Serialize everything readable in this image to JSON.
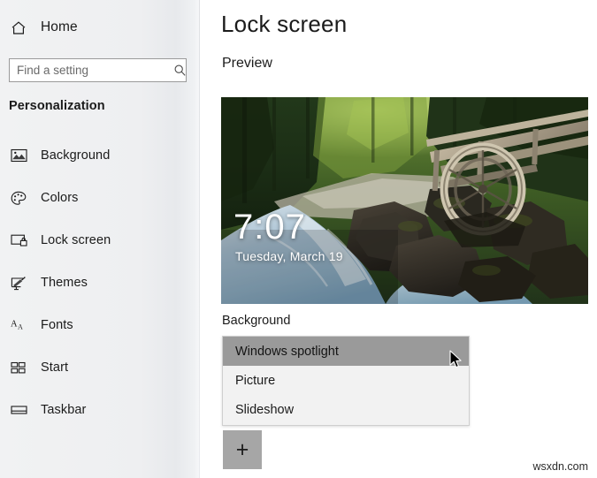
{
  "sidebar": {
    "home": {
      "label": "Home",
      "icon": "home-icon"
    },
    "search": {
      "value": "",
      "placeholder": "Find a setting",
      "icon": "search-icon"
    },
    "group_title": "Personalization",
    "items": [
      {
        "label": "Background",
        "icon": "picture-icon"
      },
      {
        "label": "Colors",
        "icon": "palette-icon"
      },
      {
        "label": "Lock screen",
        "icon": "lock-screen-icon"
      },
      {
        "label": "Themes",
        "icon": "themes-brush-icon"
      },
      {
        "label": "Fonts",
        "icon": "fonts-aa-icon"
      },
      {
        "label": "Start",
        "icon": "start-tiles-icon"
      },
      {
        "label": "Taskbar",
        "icon": "taskbar-icon"
      }
    ]
  },
  "main": {
    "page_title": "Lock screen",
    "preview_label": "Preview",
    "preview": {
      "clock": "7:07",
      "date": "Tuesday, March 19",
      "image_description": "forest stream with wooden water mill wheel"
    },
    "background_section": {
      "label": "Background",
      "selected": "Windows spotlight",
      "options": [
        "Windows spotlight",
        "Picture",
        "Slideshow"
      ]
    },
    "add_button": {
      "label": "+",
      "icon": "plus-icon"
    }
  },
  "watermark": "wsxdn.com",
  "colors": {
    "sidebar_bg": "#f1f2f3",
    "highlight": "#9a9a9a",
    "dropdown_bg": "#f2f2f2",
    "plus_button_bg": "#a6a6a6",
    "text": "#1b1b1b"
  }
}
